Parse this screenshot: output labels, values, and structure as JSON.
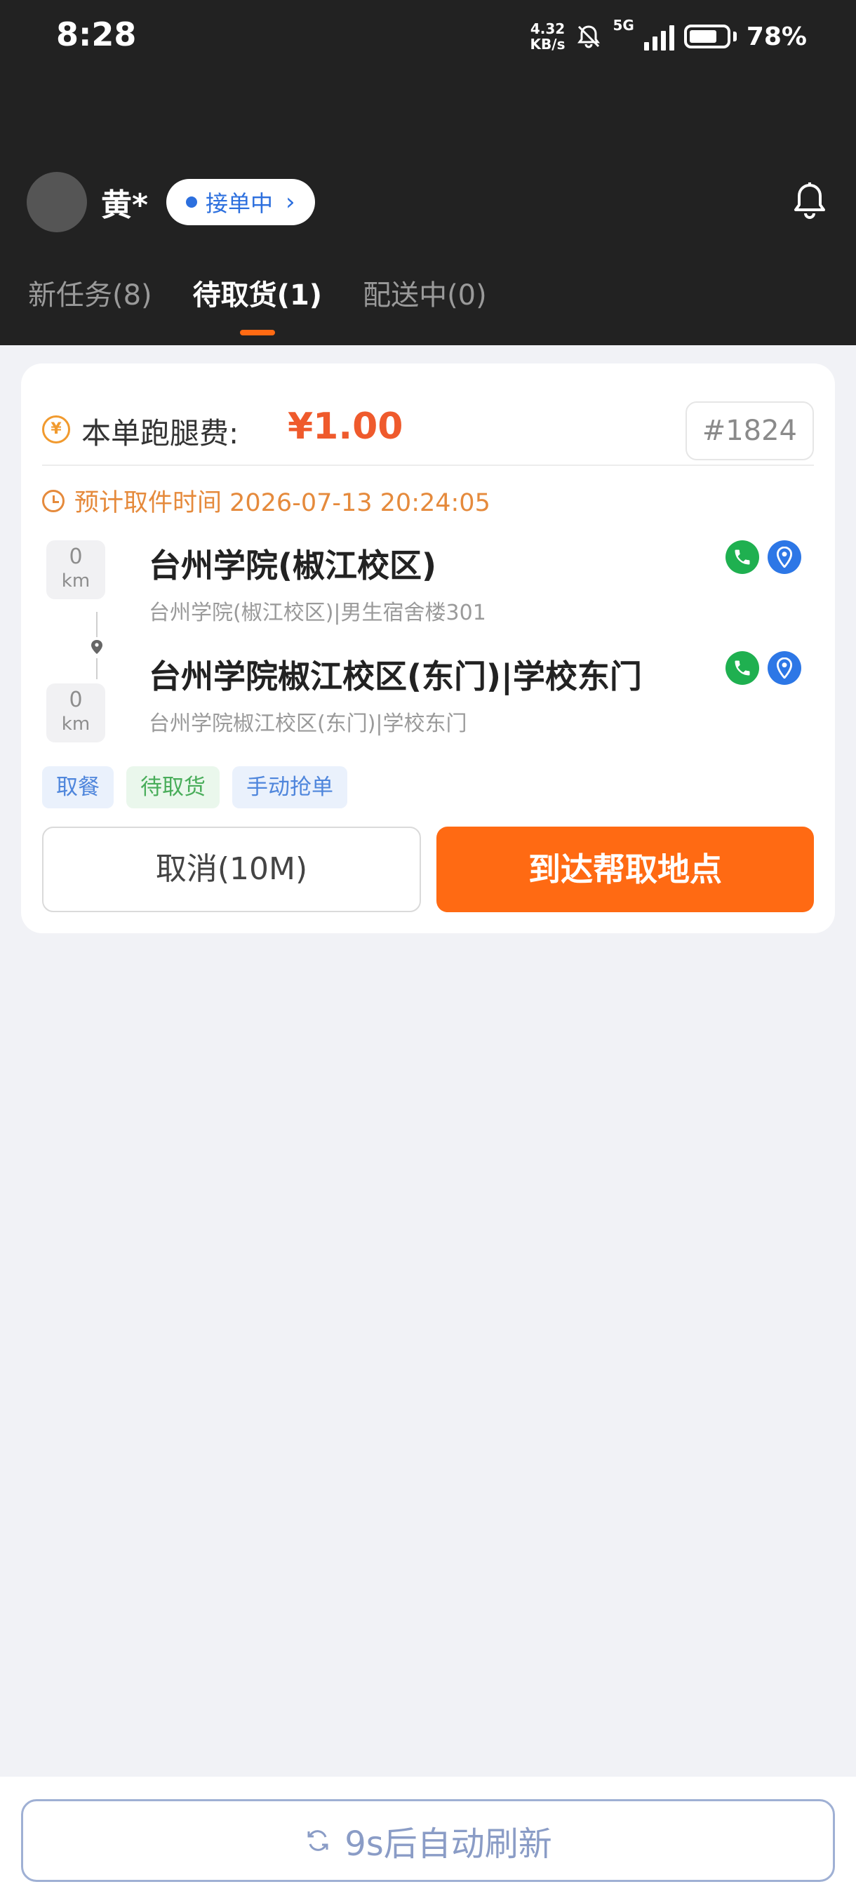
{
  "status_bar": {
    "time": "8:28",
    "net_speed_value": "4.32",
    "net_speed_unit": "KB/s",
    "network": "5G",
    "battery": "78%"
  },
  "header": {
    "user_name": "黄*",
    "status_pill": "接单中",
    "tabs": [
      {
        "label": "新任务(8)"
      },
      {
        "label": "待取货(1)"
      },
      {
        "label": "配送中(0)"
      }
    ]
  },
  "order": {
    "fee_label": "本单跑腿费:",
    "fee_value": "¥1.00",
    "order_no": "#1824",
    "pickup_time": "预计取件时间 2026-07-13 20:24:05",
    "locations": [
      {
        "dist_value": "0",
        "dist_unit": "km",
        "title": "台州学院(椒江校区)",
        "address": "台州学院(椒江校区)|男生宿舍楼301"
      },
      {
        "dist_value": "0",
        "dist_unit": "km",
        "title": "台州学院椒江校区(东门)|学校东门",
        "address": "台州学院椒江校区(东门)|学校东门"
      }
    ],
    "tags": [
      "取餐",
      "待取货",
      "手动抢单"
    ],
    "cancel_label": "取消(10M)",
    "arrive_label": "到达帮取地点"
  },
  "footer": {
    "refresh_label": "9s后自动刷新"
  },
  "colors": {
    "accent": "#ff6a13",
    "fee": "#ef5a2c",
    "header_bg": "#222222",
    "phone": "#1fb050",
    "map_pin": "#2d77e6"
  }
}
